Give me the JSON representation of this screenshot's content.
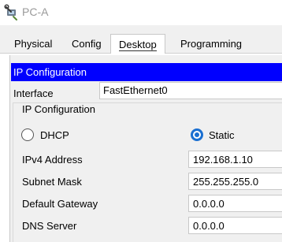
{
  "window": {
    "title": "PC-A",
    "icon": "pc-wrench-icon"
  },
  "tabs": [
    {
      "label": "Physical",
      "active": false
    },
    {
      "label": "Config",
      "active": false
    },
    {
      "label": "Desktop",
      "active": true
    },
    {
      "label": "Programming",
      "active": false
    }
  ],
  "panel": {
    "header": "IP Configuration",
    "interface_label": "Interface",
    "interface_value": "FastEthernet0",
    "group_title": "IP Configuration",
    "mode": {
      "dhcp_label": "DHCP",
      "static_label": "Static",
      "selected": "Static"
    },
    "fields": {
      "ipv4": {
        "label": "IPv4 Address",
        "value": "192.168.1.10"
      },
      "mask": {
        "label": "Subnet Mask",
        "value": "255.255.255.0"
      },
      "gateway": {
        "label": "Default Gateway",
        "value": "0.0.0.0"
      },
      "dns": {
        "label": "DNS Server",
        "value": "0.0.0.0"
      }
    }
  },
  "colors": {
    "header_bg": "#0000ff",
    "radio_accent": "#1a6fd1",
    "title_text": "#9a9a9a"
  }
}
